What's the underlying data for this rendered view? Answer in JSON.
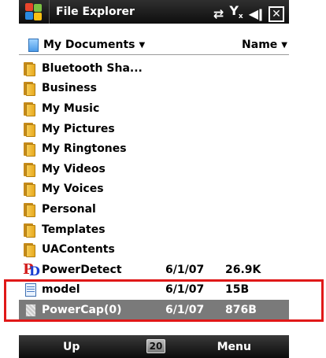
{
  "titlebar": {
    "title": "File Explorer",
    "status_icons": [
      "connectivity-icon",
      "signal-icon",
      "volume-icon"
    ],
    "close_label": "✕"
  },
  "header": {
    "folder_label": "My Documents",
    "sort_label": "Name"
  },
  "files": [
    {
      "name": "Bluetooth Sha...",
      "type": "folder",
      "date": "",
      "size": ""
    },
    {
      "name": "Business",
      "type": "folder",
      "date": "",
      "size": ""
    },
    {
      "name": "My Music",
      "type": "folder",
      "date": "",
      "size": ""
    },
    {
      "name": "My Pictures",
      "type": "folder",
      "date": "",
      "size": ""
    },
    {
      "name": "My Ringtones",
      "type": "folder",
      "date": "",
      "size": ""
    },
    {
      "name": "My Videos",
      "type": "folder",
      "date": "",
      "size": ""
    },
    {
      "name": "My Voices",
      "type": "folder",
      "date": "",
      "size": ""
    },
    {
      "name": "Personal",
      "type": "folder",
      "date": "",
      "size": ""
    },
    {
      "name": "Templates",
      "type": "folder",
      "date": "",
      "size": ""
    },
    {
      "name": "UAContents",
      "type": "folder",
      "date": "",
      "size": ""
    },
    {
      "name": "PowerDetect",
      "type": "app",
      "date": "6/1/07",
      "size": "26.9K"
    },
    {
      "name": "model",
      "type": "text",
      "date": "6/1/07",
      "size": "15B"
    },
    {
      "name": "PowerCap(0)",
      "type": "capture",
      "date": "6/1/07",
      "size": "876B",
      "selected": true
    }
  ],
  "softkeys": {
    "left": "Up",
    "center": "20",
    "right": "Menu"
  },
  "colors": {
    "highlight": "#e01818",
    "selected_row": "#7a7a7a"
  }
}
